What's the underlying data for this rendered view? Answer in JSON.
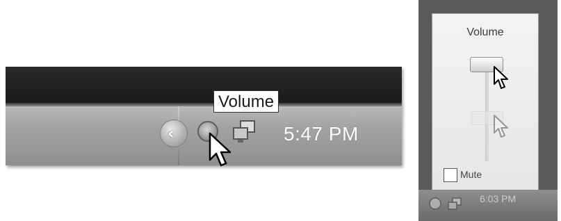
{
  "taskbar": {
    "clock": "5:47 PM",
    "tooltip": "Volume",
    "icons": [
      "show-hidden-icons-icon",
      "volume-icon",
      "network-icon"
    ]
  },
  "flyout": {
    "title": "Volume",
    "mute_label": "Mute",
    "mute_checked": false,
    "clock": "6:03 PM",
    "icons": [
      "volume-icon",
      "network-icon",
      "mouse-pointer-icon"
    ]
  }
}
